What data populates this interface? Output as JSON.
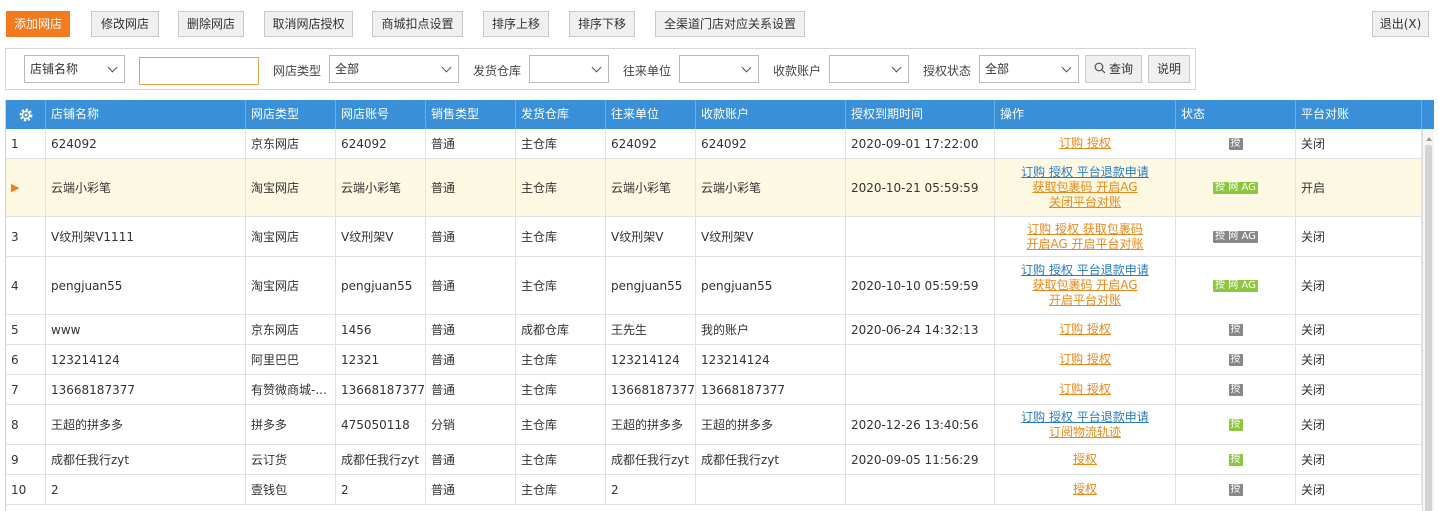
{
  "toolbar": {
    "add": "添加网店",
    "edit": "修改网店",
    "delete": "删除网店",
    "cancel_auth": "取消网店授权",
    "mall_deduct": "商城扣点设置",
    "move_up": "排序上移",
    "move_down": "排序下移",
    "channel_map": "全渠道门店对应关系设置",
    "exit": "退出(X)"
  },
  "filters": {
    "field_select": "店铺名称",
    "search_value": "",
    "shop_type_label": "网店类型",
    "shop_type_value": "全部",
    "warehouse_label": "发货仓库",
    "warehouse_value": "",
    "partner_label": "往来单位",
    "partner_value": "",
    "account_label": "收款账户",
    "account_value": "",
    "auth_status_label": "授权状态",
    "auth_status_value": "全部",
    "query": "查询",
    "help": "说明"
  },
  "columns": [
    "店铺名称",
    "网店类型",
    "网店账号",
    "销售类型",
    "发货仓库",
    "往来单位",
    "收款账户",
    "授权到期时间",
    "操作",
    "状态",
    "平台对账"
  ],
  "rows": [
    {
      "no": "1",
      "name": "624092",
      "type": "京东网店",
      "account": "624092",
      "sale": "普通",
      "warehouse": "主仓库",
      "partner": "624092",
      "receipt": "624092",
      "expire": "2020-09-01 17:22:00",
      "op1": "订购  授权",
      "op2": "",
      "op3": "",
      "status": "授",
      "statuses": [
        "gray"
      ],
      "recon": "关闭"
    },
    {
      "no": "",
      "name": "云端小彩笔",
      "type": "淘宝网店",
      "account": "云端小彩笔",
      "sale": "普通",
      "warehouse": "主仓库",
      "partner": "云端小彩笔",
      "receipt": "云端小彩笔",
      "expire": "2020-10-21 05:59:59",
      "op1": "订购  授权  平台退款申请",
      "op2": "获取包裹码  开启AG",
      "op3": "关闭平台对账",
      "status": "授 网 AG",
      "statuses": [
        "green",
        "lgray",
        "gray"
      ],
      "recon": "开启"
    },
    {
      "no": "3",
      "name": "V纹刑架V1111",
      "type": "淘宝网店",
      "account": "V纹刑架V",
      "sale": "普通",
      "warehouse": "主仓库",
      "partner": "V纹刑架V",
      "receipt": "V纹刑架V",
      "expire": "",
      "op1": "订购  授权  获取包裹码",
      "op2": "开启AG  开启平台对账",
      "op3": "",
      "status": "授 网 AG",
      "statuses": [
        "gray",
        "lgray",
        "gray"
      ],
      "recon": "关闭"
    },
    {
      "no": "4",
      "name": "pengjuan55",
      "type": "淘宝网店",
      "account": "pengjuan55",
      "sale": "普通",
      "warehouse": "主仓库",
      "partner": "pengjuan55",
      "receipt": "pengjuan55",
      "expire": "2020-10-10 05:59:59",
      "op1": "订购  授权  平台退款申请",
      "op2": "获取包裹码  开启AG",
      "op3": "开启平台对账",
      "status": "授 网 AG",
      "statuses": [
        "green",
        "lgray",
        "gray"
      ],
      "recon": "关闭"
    },
    {
      "no": "5",
      "name": "www",
      "type": "京东网店",
      "account": "1456",
      "sale": "普通",
      "warehouse": "成都仓库",
      "partner": "王先生",
      "receipt": "我的账户",
      "expire": "2020-06-24 14:32:13",
      "op1": "订购  授权",
      "op2": "",
      "op3": "",
      "status": "授",
      "statuses": [
        "gray"
      ],
      "recon": "关闭"
    },
    {
      "no": "6",
      "name": "123214124",
      "type": "阿里巴巴",
      "account": "12321",
      "sale": "普通",
      "warehouse": "主仓库",
      "partner": "123214124",
      "receipt": "123214124",
      "expire": "",
      "op1": "订购  授权",
      "op2": "",
      "op3": "",
      "status": "授",
      "statuses": [
        "gray"
      ],
      "recon": "关闭"
    },
    {
      "no": "7",
      "name": "13668187377",
      "type": "有赞微商城-...",
      "account": "13668187377",
      "sale": "普通",
      "warehouse": "主仓库",
      "partner": "13668187377",
      "receipt": "13668187377",
      "expire": "",
      "op1": "订购  授权",
      "op2": "",
      "op3": "",
      "status": "授",
      "statuses": [
        "gray"
      ],
      "recon": "关闭"
    },
    {
      "no": "8",
      "name": "王超的拼多多",
      "type": "拼多多",
      "account": "475050118",
      "sale": "分销",
      "warehouse": "主仓库",
      "partner": "王超的拼多多",
      "receipt": "王超的拼多多",
      "expire": "2020-12-26 13:40:56",
      "op1": "订购  授权  平台退款申请",
      "op2": "订阅物流轨迹",
      "op3": "",
      "status": "授",
      "statuses": [
        "green"
      ],
      "recon": "关闭"
    },
    {
      "no": "9",
      "name": "成都任我行zyt",
      "type": "云订货",
      "account": "成都任我行zyt",
      "sale": "普通",
      "warehouse": "主仓库",
      "partner": "成都任我行zyt",
      "receipt": "成都任我行zyt",
      "expire": "2020-09-05 11:56:29",
      "op1": "授权",
      "op2": "",
      "op3": "",
      "status": "授",
      "statuses": [
        "green"
      ],
      "recon": "关闭"
    },
    {
      "no": "10",
      "name": "2",
      "type": "壹钱包",
      "account": "2",
      "sale": "普通",
      "warehouse": "主仓库",
      "partner": "2",
      "receipt": "",
      "expire": "",
      "op1": "授权",
      "op2": "",
      "op3": "",
      "status": "授",
      "statuses": [
        "gray"
      ],
      "recon": "关闭"
    }
  ]
}
